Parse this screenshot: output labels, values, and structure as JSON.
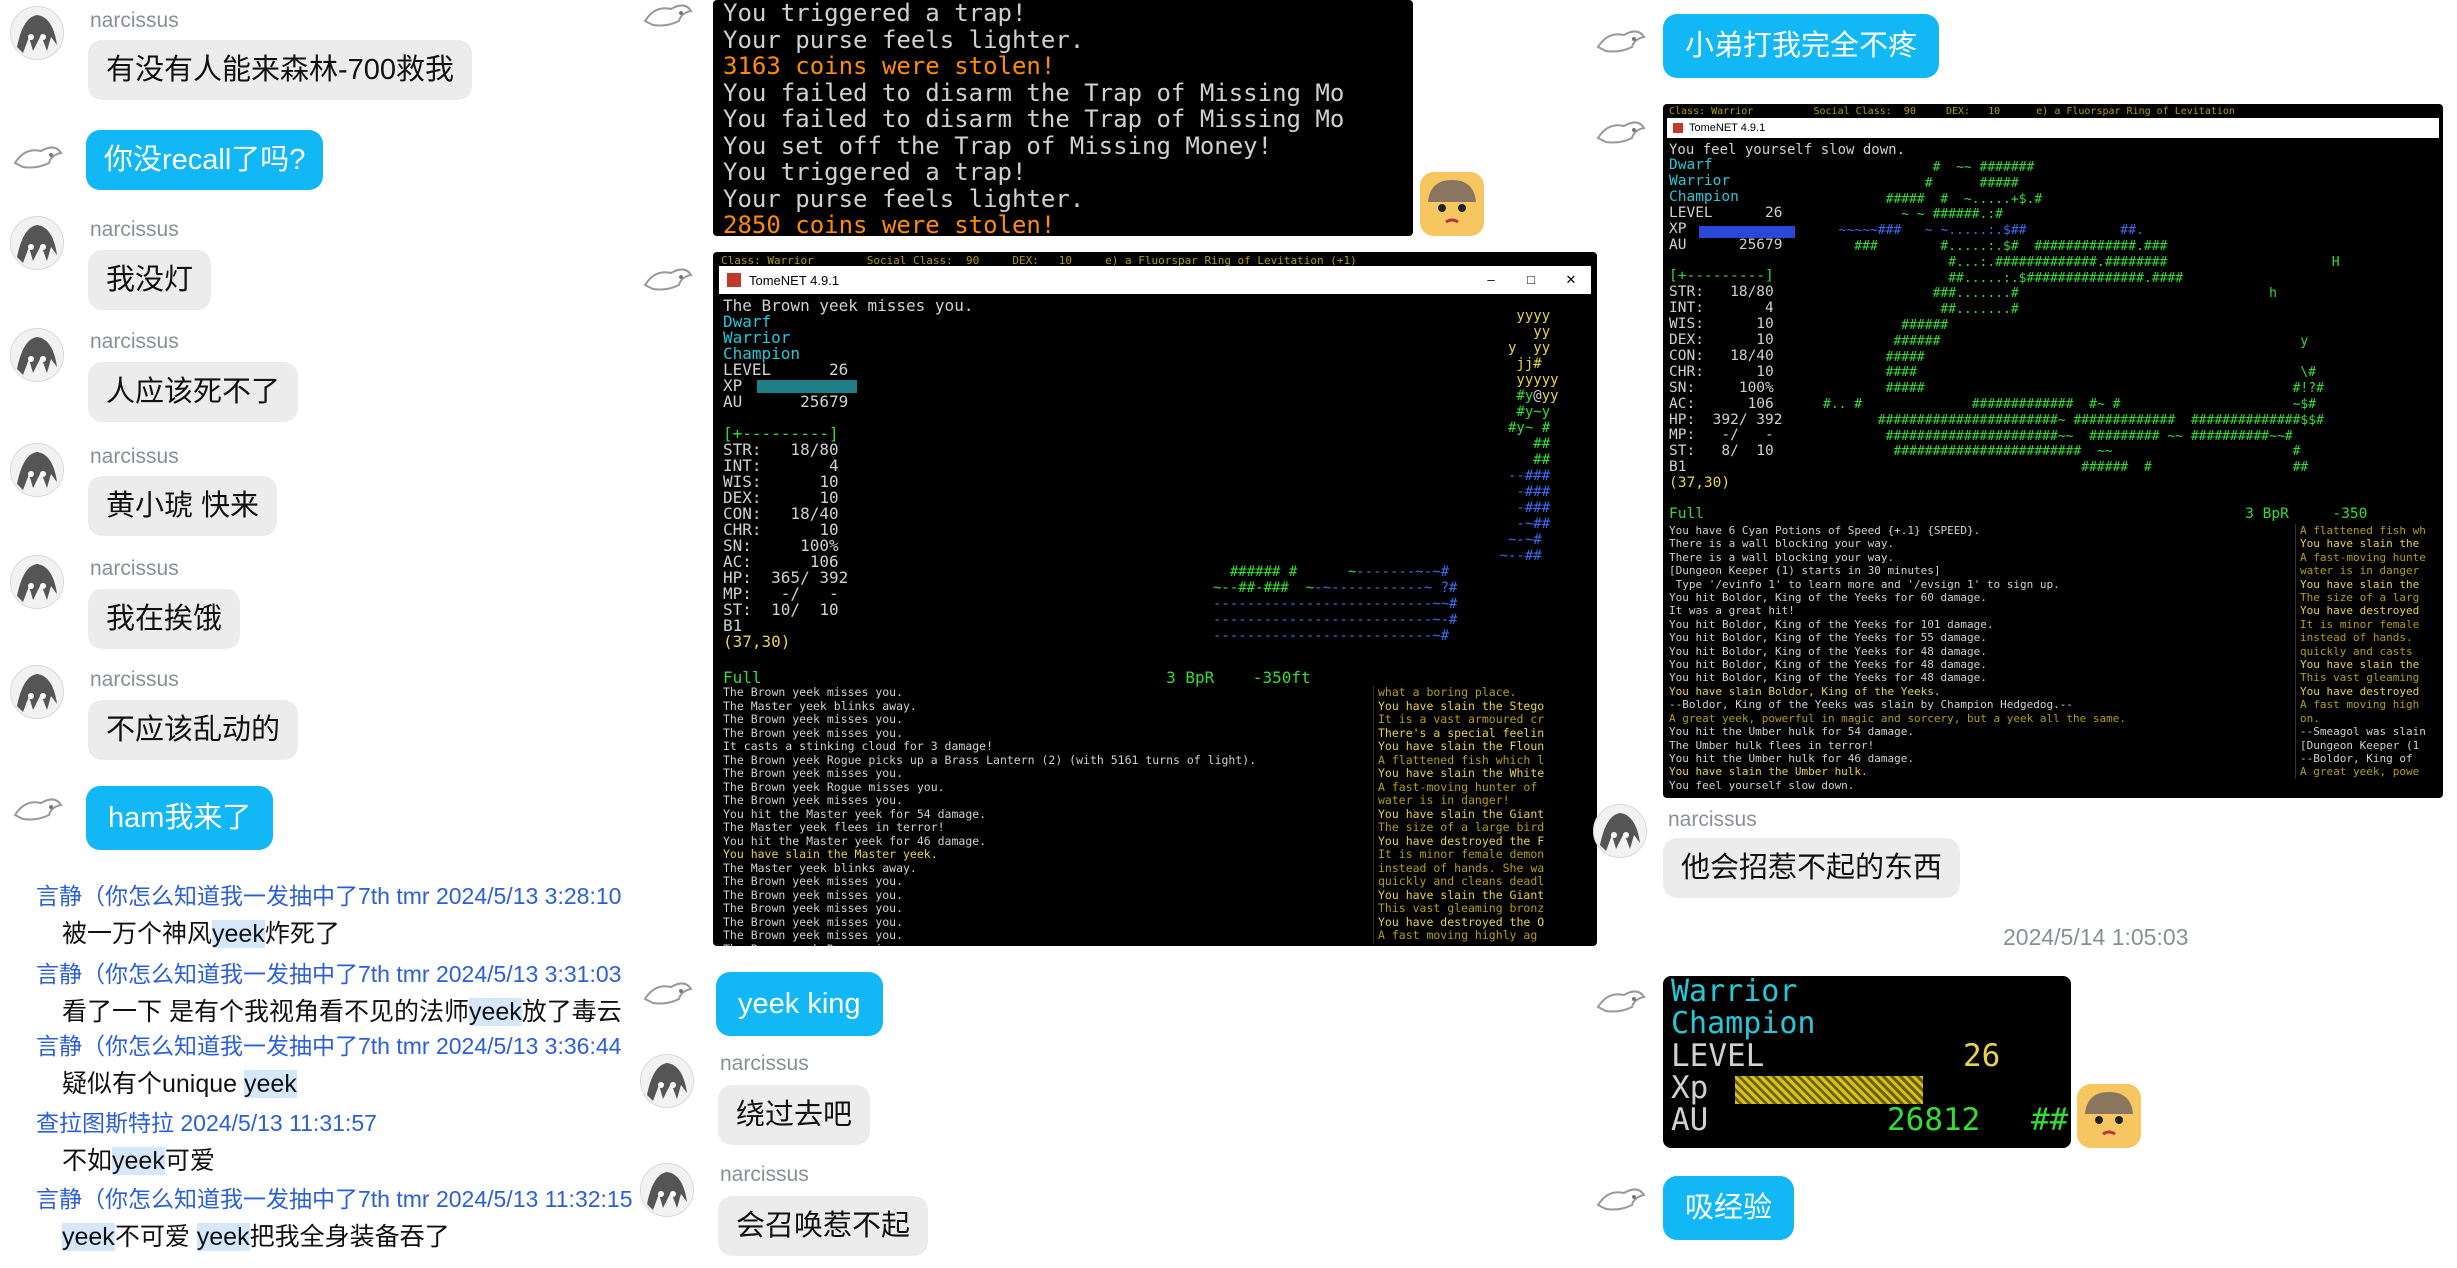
{
  "left": {
    "messages": [
      {
        "sender": "narcissus",
        "text": "有没有人能来森林-700救我",
        "side": "grey"
      },
      {
        "sender": "",
        "text": "你没recall了吗?",
        "side": "blue"
      },
      {
        "sender": "narcissus",
        "text": "我没灯",
        "side": "grey"
      },
      {
        "sender": "narcissus",
        "text": "人应该死不了",
        "side": "grey"
      },
      {
        "sender": "narcissus",
        "text": "黄小琥 快来",
        "side": "grey"
      },
      {
        "sender": "narcissus",
        "text": "我在挨饿",
        "side": "grey"
      },
      {
        "sender": "narcissus",
        "text": "不应该乱动的",
        "side": "grey"
      },
      {
        "sender": "",
        "text": "ham我来了",
        "side": "blue"
      }
    ],
    "forwarded": [
      {
        "header": "言静（你怎么知道我一发抽中了7th tmr 2024/5/13 3:28:10",
        "body_pre": "被一万个神风",
        "hl1": "yeek",
        "body_mid": "炸死了",
        "hl2": "",
        "body_post": ""
      },
      {
        "header": "言静（你怎么知道我一发抽中了7th tmr 2024/5/13 3:31:03",
        "body_pre": "看了一下 是有个我视角看不见的法师",
        "hl1": "yeek",
        "body_mid": "放了毒云",
        "hl2": "",
        "body_post": ""
      },
      {
        "header": "言静（你怎么知道我一发抽中了7th tmr 2024/5/13 3:36:44",
        "body_pre": "疑似有个unique ",
        "hl1": "yeek",
        "body_mid": "",
        "hl2": "",
        "body_post": ""
      },
      {
        "header": "查拉图斯特拉 2024/5/13 11:31:57",
        "body_pre": "不如",
        "hl1": "yeek",
        "body_mid": "可爱",
        "hl2": "",
        "body_post": ""
      },
      {
        "header": "言静（你怎么知道我一发抽中了7th tmr 2024/5/13 11:32:15",
        "body_pre": "",
        "hl1": "yeek",
        "body_mid": "不可爱 ",
        "hl2": "yeek",
        "body_post": "把我全身装备吞了"
      }
    ]
  },
  "middle": {
    "term1_lines": [
      {
        "t": "You triggered a trap!",
        "c": "c-w"
      },
      {
        "t": "Your purse feels lighter.",
        "c": "c-w"
      },
      {
        "t": "3163 coins were stolen!",
        "c": "c-o"
      },
      {
        "t": "You failed to disarm the Trap of Missing Mo",
        "c": "c-w"
      },
      {
        "t": "You failed to disarm the Trap of Missing Mo",
        "c": "c-w"
      },
      {
        "t": "You set off the Trap of Missing Money!",
        "c": "c-w"
      },
      {
        "t": "You triggered a trap!",
        "c": "c-w"
      },
      {
        "t": "Your purse feels lighter.",
        "c": "c-w"
      },
      {
        "t": "2850 coins were stolen!",
        "c": "c-o"
      }
    ],
    "term2": {
      "topbar": "Class: Warrior        Social Class:  90     DEX:   10     e) a Fluorspar Ring of Levitation (+1)",
      "window_title": "TomeNET 4.9.1",
      "first_line": "The Brown yeek misses you.",
      "stats": [
        {
          "t": "Dwarf",
          "c": "c-c"
        },
        {
          "t": "Warrior",
          "c": "c-c"
        },
        {
          "t": "Champion",
          "c": "c-c"
        },
        {
          "t": "LEVEL      26",
          "c": "c-w"
        },
        {
          "t": "XP",
          "c": "c-w"
        },
        {
          "t": "AU      25679",
          "c": "c-w"
        },
        {
          "t": "",
          "c": "c-w"
        },
        {
          "t": "[+---------]",
          "c": "c-g"
        },
        {
          "t": "STR:   18/80",
          "c": "c-w"
        },
        {
          "t": "INT:       4",
          "c": "c-w"
        },
        {
          "t": "WIS:      10",
          "c": "c-w"
        },
        {
          "t": "DEX:      10",
          "c": "c-w"
        },
        {
          "t": "CON:   18/40",
          "c": "c-w"
        },
        {
          "t": "CHR:      10",
          "c": "c-w"
        },
        {
          "t": "SN:     100%",
          "c": "c-w"
        },
        {
          "t": "AC:      106",
          "c": "c-w"
        },
        {
          "t": "HP:  365/ 392",
          "c": "c-w"
        },
        {
          "t": "MP:   -/   -",
          "c": "c-w"
        },
        {
          "t": "ST:  10/  10",
          "c": "c-w"
        },
        {
          "t": "B1",
          "c": "c-w"
        },
        {
          "t": "(37,30)",
          "c": "c-y"
        }
      ],
      "full_line": "Full                                          3 BpR    -350ft",
      "log": [
        {
          "t": "The Brown yeek misses you.",
          "c": "c-w"
        },
        {
          "t": "The Master yeek blinks away.",
          "c": "c-w"
        },
        {
          "t": "The Brown yeek misses you.",
          "c": "c-w"
        },
        {
          "t": "The Brown yeek misses you.",
          "c": "c-w"
        },
        {
          "t": "It casts a stinking cloud for 3 damage!",
          "c": "c-w"
        },
        {
          "t": "The Brown yeek Rogue picks up a Brass Lantern (2) (with 5161 turns of light).",
          "c": "c-w"
        },
        {
          "t": "The Brown yeek misses you.",
          "c": "c-w"
        },
        {
          "t": "The Brown yeek Rogue misses you.",
          "c": "c-w"
        },
        {
          "t": "The Brown yeek misses you.",
          "c": "c-w"
        },
        {
          "t": "You hit the Master yeek for 54 damage.",
          "c": "c-w"
        },
        {
          "t": "The Master yeek flees in terror!",
          "c": "c-w"
        },
        {
          "t": "You hit the Master yeek for 46 damage.",
          "c": "c-w"
        },
        {
          "t": "You have slain the Master yeek.",
          "c": "c-y"
        },
        {
          "t": "The Master yeek blinks away.",
          "c": "c-w"
        },
        {
          "t": "The Brown yeek misses you.",
          "c": "c-w"
        },
        {
          "t": "The Brown yeek misses you.",
          "c": "c-w"
        },
        {
          "t": "The Brown yeek misses you.",
          "c": "c-w"
        },
        {
          "t": "The Brown yeek misses you.",
          "c": "c-w"
        },
        {
          "t": "The Brown yeek misses you.",
          "c": "c-w"
        },
        {
          "t": "The Brown yeek Rogue misses you.",
          "c": "c-w"
        }
      ],
      "side_log": [
        {
          "t": "what a boring place.",
          "c": "c-dy"
        },
        {
          "t": "You have slain the Stego",
          "c": "c-y"
        },
        {
          "t": "It is a vast armoured cr",
          "c": "c-dy"
        },
        {
          "t": "There's a special feelin",
          "c": "c-y"
        },
        {
          "t": "You have slain the Floun",
          "c": "c-y"
        },
        {
          "t": "A flattened fish which l",
          "c": "c-dy"
        },
        {
          "t": "You have slain the White",
          "c": "c-y"
        },
        {
          "t": "A fast-moving hunter of",
          "c": "c-dy"
        },
        {
          "t": "water is in danger!",
          "c": "c-dy"
        },
        {
          "t": "You have slain the Giant",
          "c": "c-y"
        },
        {
          "t": "The size of a large bird",
          "c": "c-dy"
        },
        {
          "t": "You have destroyed the F",
          "c": "c-y"
        },
        {
          "t": "It is minor female demon",
          "c": "c-dy"
        },
        {
          "t": "instead of hands. She wa",
          "c": "c-dy"
        },
        {
          "t": "quickly and cleans deadl",
          "c": "c-dy"
        },
        {
          "t": "You have slain the Giant",
          "c": "c-y"
        },
        {
          "t": "This vast gleaming bronz",
          "c": "c-dy"
        },
        {
          "t": "You have destroyed the O",
          "c": "c-y"
        },
        {
          "t": "A fast moving highly ag",
          "c": "c-dy"
        }
      ]
    },
    "messages": [
      {
        "sender": "",
        "text": "yeek king",
        "side": "blue"
      },
      {
        "sender": "narcissus",
        "text": "绕过去吧",
        "side": "grey"
      },
      {
        "sender": "narcissus",
        "text": "会召唤惹不起",
        "side": "grey"
      }
    ]
  },
  "right": {
    "msg_top": "小弟打我完全不疼",
    "term3": {
      "topbar": "Class: Warrior          Social Class:  90     DEX:   10      e) a Fluorspar Ring of Levitation",
      "window_title": "TomeNET 4.9.1",
      "first_line": "You feel yourself slow down.",
      "stats": [
        {
          "t": "Dwarf",
          "c": "c-c"
        },
        {
          "t": "Warrior",
          "c": "c-c"
        },
        {
          "t": "Champion",
          "c": "c-c"
        },
        {
          "t": "LEVEL      26",
          "c": "c-w"
        },
        {
          "t": "XP",
          "c": "c-w"
        },
        {
          "t": "AU      25679",
          "c": "c-w"
        },
        {
          "t": "",
          "c": "c-w"
        },
        {
          "t": "[+---------]",
          "c": "c-g"
        },
        {
          "t": "STR:   18/80",
          "c": "c-w"
        },
        {
          "t": "INT:       4",
          "c": "c-w"
        },
        {
          "t": "WIS:      10",
          "c": "c-w"
        },
        {
          "t": "DEX:      10",
          "c": "c-w"
        },
        {
          "t": "CON:   18/40",
          "c": "c-w"
        },
        {
          "t": "CHR:      10",
          "c": "c-w"
        },
        {
          "t": "SN:     100%",
          "c": "c-w"
        },
        {
          "t": "AC:      106",
          "c": "c-w"
        },
        {
          "t": "HP:  392/ 392",
          "c": "c-w"
        },
        {
          "t": "MP:   -/   -",
          "c": "c-w"
        },
        {
          "t": "ST:   8/  10",
          "c": "c-w"
        },
        {
          "t": "B1",
          "c": "c-w"
        },
        {
          "t": "(37,30)",
          "c": "c-y"
        }
      ],
      "full_line": "Full                                                              3 BpR     -350",
      "log": [
        {
          "t": "You have 6 Cyan Potions of Speed {+.1} {SPEED}.",
          "c": "c-w"
        },
        {
          "t": "There is a wall blocking your way.",
          "c": "c-w"
        },
        {
          "t": "There is a wall blocking your way.",
          "c": "c-w"
        },
        {
          "t": "[Dungeon Keeper (1) starts in 30 minutes]",
          "c": "c-w"
        },
        {
          "t": " Type '/evinfo 1' to learn more and '/evsign 1' to sign up.",
          "c": "c-w"
        },
        {
          "t": "You hit Boldor, King of the Yeeks for 60 damage.",
          "c": "c-w"
        },
        {
          "t": "It was a great hit!",
          "c": "c-w"
        },
        {
          "t": "You hit Boldor, King of the Yeeks for 101 damage.",
          "c": "c-w"
        },
        {
          "t": "You hit Boldor, King of the Yeeks for 55 damage.",
          "c": "c-w"
        },
        {
          "t": "You hit Boldor, King of the Yeeks for 48 damage.",
          "c": "c-w"
        },
        {
          "t": "You hit Boldor, King of the Yeeks for 48 damage.",
          "c": "c-w"
        },
        {
          "t": "You hit Boldor, King of the Yeeks for 48 damage.",
          "c": "c-w"
        },
        {
          "t": "You have slain Boldor, King of the Yeeks.",
          "c": "c-y"
        },
        {
          "t": "--Boldor, King of the Yeeks was slain by Champion Hedgedog.--",
          "c": "c-w"
        },
        {
          "t": "A great yeek, powerful in magic and sorcery, but a yeek all the same.",
          "c": "c-dy"
        },
        {
          "t": "You hit the Umber hulk for 54 damage.",
          "c": "c-w"
        },
        {
          "t": "The Umber hulk flees in terror!",
          "c": "c-w"
        },
        {
          "t": "You hit the Umber hulk for 46 damage.",
          "c": "c-w"
        },
        {
          "t": "You have slain the Umber hulk.",
          "c": "c-y"
        },
        {
          "t": "You feel yourself slow down.",
          "c": "c-w"
        }
      ],
      "side_log": [
        {
          "t": "A flattened fish wh",
          "c": "c-dy"
        },
        {
          "t": "You have slain the",
          "c": "c-y"
        },
        {
          "t": "A fast-moving hunte",
          "c": "c-dy"
        },
        {
          "t": "water is in danger",
          "c": "c-dy"
        },
        {
          "t": "You have slain the",
          "c": "c-y"
        },
        {
          "t": "The size of a larg",
          "c": "c-dy"
        },
        {
          "t": "You have destroyed",
          "c": "c-y"
        },
        {
          "t": "It is minor female",
          "c": "c-dy"
        },
        {
          "t": "instead of hands.",
          "c": "c-dy"
        },
        {
          "t": "quickly and casts",
          "c": "c-dy"
        },
        {
          "t": "You have slain the",
          "c": "c-y"
        },
        {
          "t": "This vast gleaming",
          "c": "c-dy"
        },
        {
          "t": "You have destroyed",
          "c": "c-y"
        },
        {
          "t": "A fast moving high",
          "c": "c-dy"
        },
        {
          "t": "on.",
          "c": "c-dy"
        },
        {
          "t": "--Smeagol was slain",
          "c": "c-w"
        },
        {
          "t": "[Dungeon Keeper (1",
          "c": "c-w"
        },
        {
          "t": "--Boldor, King of",
          "c": "c-w"
        },
        {
          "t": "A great yeek, powe",
          "c": "c-dy"
        }
      ]
    },
    "narcissus_name": "narcissus",
    "msg_mid": "他会招惹不起的东西",
    "timestamp": "2024/5/14 1:05:03",
    "term4": {
      "class_line": "Warrior",
      "title_line": "Champion",
      "level_label": "LEVEL",
      "level_value": "26",
      "xp_label": "Xp",
      "au_label": "AU",
      "au_value": "26812",
      "tail": "##"
    },
    "msg_bottom": "吸经验"
  },
  "colors": {
    "blue_bubble": "#12b7f5",
    "grey_bubble": "#ececec",
    "forward_header": "#2b5fd9"
  }
}
